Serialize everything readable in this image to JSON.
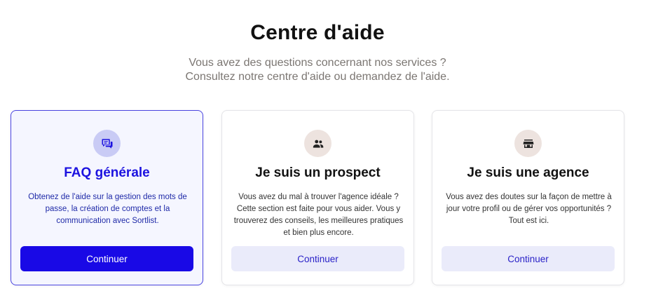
{
  "header": {
    "title": "Centre d'aide",
    "subtitle_line1": "Vous avez des questions concernant nos services ?",
    "subtitle_line2": "Consultez notre centre d'aide ou demandez de l'aide."
  },
  "cards": [
    {
      "icon": "chat-bubbles-icon",
      "title": "FAQ générale",
      "description": "Obtenez de l'aide sur la gestion des mots de passe, la création de comptes et la communication avec Sortlist.",
      "button_label": "Continuer",
      "active": true
    },
    {
      "icon": "people-icon",
      "title": "Je suis un prospect",
      "description": "Vous avez du mal à trouver l'agence idéale ? Cette section est faite pour vous aider. Vous y trouverez des conseils, les meilleures pratiques et bien plus encore.",
      "button_label": "Continuer",
      "active": false
    },
    {
      "icon": "storefront-icon",
      "title": "Je suis une agence",
      "description": "Vous avez des doutes sur la façon de mettre à jour votre profil ou de gérer vos opportunités ? Tout est ici.",
      "button_label": "Continuer",
      "active": false
    }
  ],
  "colors": {
    "accent": "#1909e6",
    "active_card_bg": "#f5f6ff",
    "secondary_button_bg": "#eaebfa",
    "icon_bg_active": "#c9cbf5",
    "icon_bg_neutral": "#ede3df"
  }
}
